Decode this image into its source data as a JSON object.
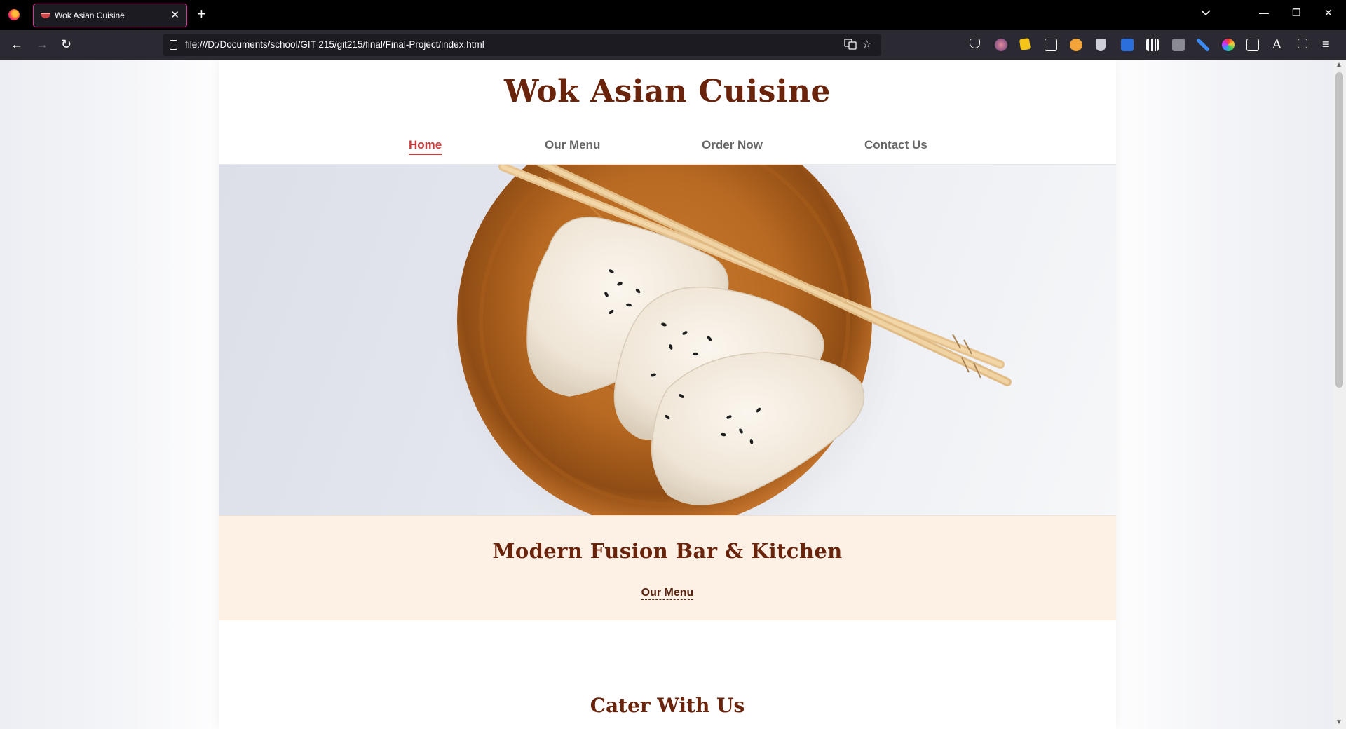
{
  "browser": {
    "tab_title": "Wok Asian Cuisine",
    "url": "file:///D:/Documents/school/GIT 215/git215/final/Final-Project/index.html",
    "close_glyph": "✕",
    "new_tab_glyph": "+",
    "back_glyph": "←",
    "forward_glyph": "→",
    "reload_glyph": "↻",
    "bookmark_glyph": "☆",
    "tab_list_glyph": "⌄",
    "menu_glyph": "≡",
    "minimize_glyph": "—",
    "restore_glyph": "❐",
    "window_close_glyph": "✕"
  },
  "site": {
    "title": "Wok Asian Cuisine",
    "nav": [
      {
        "label": "Home",
        "active": true
      },
      {
        "label": "Our Menu",
        "active": false
      },
      {
        "label": "Order Now",
        "active": false
      },
      {
        "label": "Contact Us",
        "active": false
      }
    ],
    "hero": {
      "image": "dumplings-on-wooden-plate-with-chopsticks"
    },
    "band": {
      "title": "Modern Fusion Bar & Kitchen",
      "link": "Our Menu"
    },
    "section_title": "Cater With Us"
  },
  "colors": {
    "title_brown": "#6a240c",
    "nav_active": "#c83b3b",
    "band_bg": "#fdf1e6",
    "tab_border": "#d9349a"
  }
}
